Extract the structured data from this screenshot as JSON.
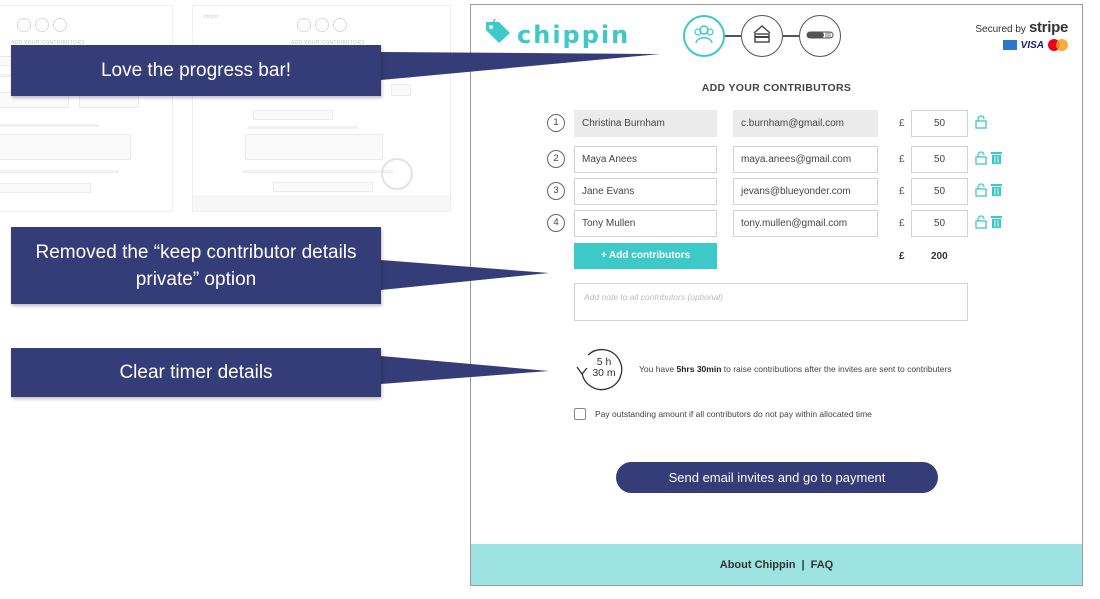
{
  "app": {
    "brand": "chippin",
    "secured_by": "Secured by",
    "stripe": "stripe",
    "card_visa": "VISA",
    "section_title": "ADD YOUR CONTRIBUTORS",
    "currency_symbol": "£",
    "contributors": [
      {
        "num": "1",
        "name": "Christina Burnham",
        "email": "c.burnham@gmail.com",
        "amount": "50",
        "locked": true
      },
      {
        "num": "2",
        "name": "Maya Anees",
        "email": "maya.anees@gmail.com",
        "amount": "50",
        "locked": false
      },
      {
        "num": "3",
        "name": "Jane Evans",
        "email": "jevans@blueyonder.com",
        "amount": "50",
        "locked": false
      },
      {
        "num": "4",
        "name": "Tony Mullen",
        "email": "tony.mullen@gmail.com",
        "amount": "50",
        "locked": false
      }
    ],
    "add_contributors_label": "+ Add contributors",
    "total": "200",
    "note_placeholder": "Add note to all contributors (optional)",
    "timer": {
      "hours": "5 h",
      "minutes": "30 m"
    },
    "timer_message": {
      "before": "You have ",
      "bold": "5hrs 30min",
      "after": " to raise contributions after the invites are sent to contributers"
    },
    "pay_outstanding_label": "Pay outstanding amount if all contributors do not pay within allocated time",
    "send_button": "Send email invites and go to payment",
    "footer": {
      "about": "About Chippin",
      "separator": "|",
      "faq": "FAQ"
    },
    "colors": {
      "teal": "#3cc9c7",
      "navy": "#343d78",
      "footer": "#9de3e1"
    },
    "steps": [
      {
        "icon": "contributors-icon",
        "active": true
      },
      {
        "icon": "card-payment-icon",
        "active": false
      },
      {
        "icon": "progress-bar-icon",
        "active": false
      }
    ]
  },
  "annotations": [
    {
      "text": "Love the progress bar!"
    },
    {
      "line1": "Removed the “keep contributor details",
      "line2": "private” option"
    },
    {
      "text": "Clear timer details"
    }
  ],
  "ghost": {
    "title": "ADD YOUR CONTRIBUTORS",
    "brand": "chippin"
  }
}
